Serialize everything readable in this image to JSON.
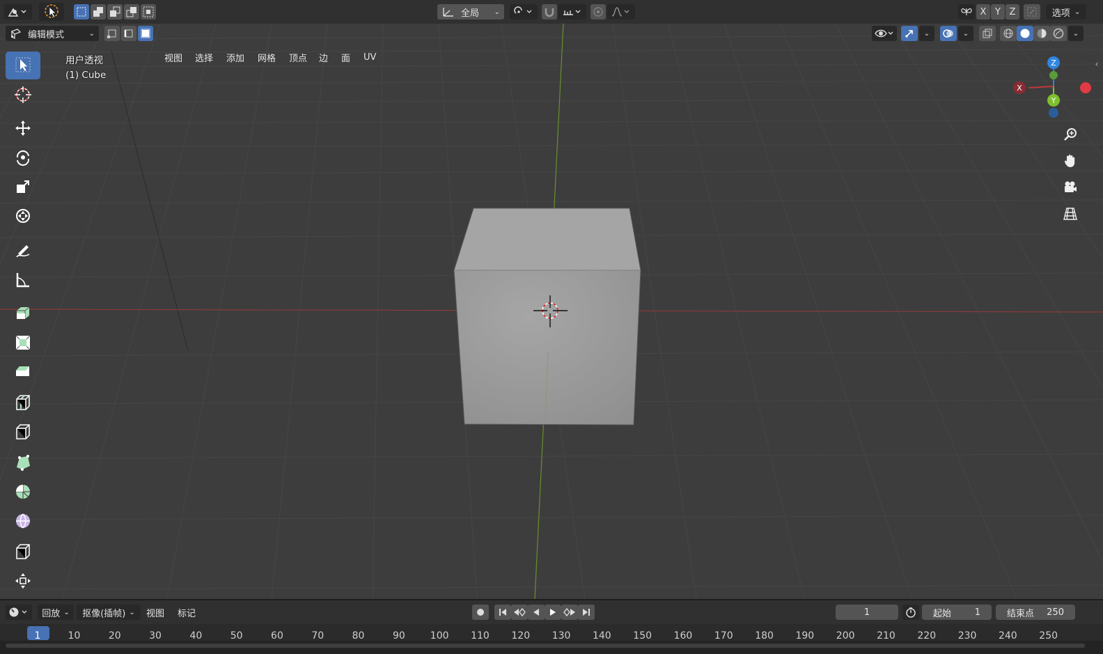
{
  "header": {
    "orientation_label": "全局",
    "axis_x": "X",
    "axis_y": "Y",
    "axis_z": "Z",
    "options_label": "选项"
  },
  "viewport_header": {
    "mode_label": "编辑模式",
    "menus": [
      "视图",
      "选择",
      "添加",
      "网格",
      "顶点",
      "边",
      "面",
      "UV"
    ]
  },
  "viewport": {
    "view_name": "用户透视",
    "object_name": "(1) Cube",
    "gizmo": {
      "x": "X",
      "y": "Y",
      "z": "Z"
    }
  },
  "tools": [
    {
      "name": "select-box-tool",
      "icon": "cursor-select-icon",
      "active": true
    },
    {
      "name": "cursor-tool",
      "icon": "3d-cursor-icon",
      "active": false
    },
    {
      "name": "move-tool",
      "icon": "move-icon",
      "active": false
    },
    {
      "name": "rotate-tool",
      "icon": "rotate-icon",
      "active": false
    },
    {
      "name": "scale-tool",
      "icon": "scale-icon",
      "active": false
    },
    {
      "name": "transform-tool",
      "icon": "transform-icon",
      "active": false
    },
    {
      "name": "annotate-tool",
      "icon": "annotate-icon",
      "active": false
    },
    {
      "name": "measure-tool",
      "icon": "measure-icon",
      "active": false
    },
    {
      "name": "extrude-tool",
      "icon": "extrude-icon",
      "active": false
    },
    {
      "name": "inset-tool",
      "icon": "inset-icon",
      "active": false
    },
    {
      "name": "bevel-tool",
      "icon": "bevel-icon",
      "active": false
    },
    {
      "name": "loop-cut-tool",
      "icon": "loop-cut-icon",
      "active": false
    },
    {
      "name": "knife-tool",
      "icon": "knife-icon",
      "active": false
    },
    {
      "name": "poly-build-tool",
      "icon": "poly-build-icon",
      "active": false
    },
    {
      "name": "spin-tool",
      "icon": "spin-icon",
      "active": false
    },
    {
      "name": "smooth-tool",
      "icon": "smooth-icon",
      "active": false
    },
    {
      "name": "edge-slide-tool",
      "icon": "edge-slide-icon",
      "active": false
    },
    {
      "name": "shrink-fatten-tool",
      "icon": "shrink-fatten-icon",
      "active": false
    }
  ],
  "timeline": {
    "playback_label": "回放",
    "keying_label": "抠像(插帧)",
    "view_label": "视图",
    "marker_label": "标记",
    "current_frame": "1",
    "start_label": "起始",
    "start_value": "1",
    "end_label": "结束点",
    "end_value": "250",
    "ticks": [
      "1",
      "10",
      "20",
      "30",
      "40",
      "50",
      "60",
      "70",
      "80",
      "90",
      "100",
      "110",
      "120",
      "130",
      "140",
      "150",
      "160",
      "170",
      "180",
      "190",
      "200",
      "210",
      "220",
      "230",
      "240",
      "250"
    ]
  },
  "colors": {
    "accent": "#4772b3",
    "x_axis": "#c0393b",
    "y_axis": "#7fbf2e",
    "z_axis": "#2f86e0",
    "tool_icon_green": "#a8e0b8"
  }
}
